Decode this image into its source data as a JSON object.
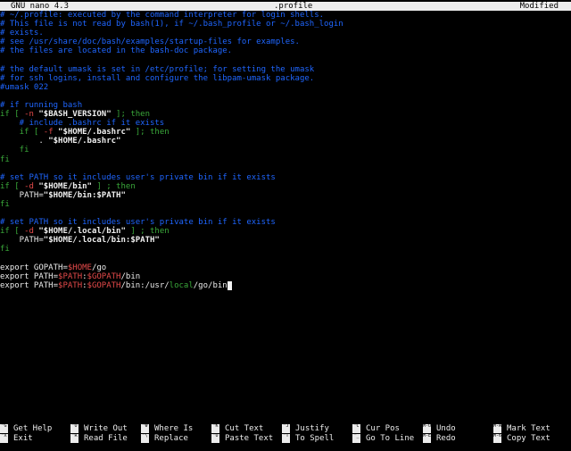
{
  "titlebar": {
    "app": "GNU nano 4.3",
    "filename": ".profile",
    "status": "Modified"
  },
  "editor": {
    "lines": [
      [
        {
          "c": "c",
          "t": "# ~/.profile: executed by the command interpreter for login shells."
        }
      ],
      [
        {
          "c": "c",
          "t": "# This file is not read by bash(1), if ~/.bash_profile or ~/.bash_login"
        }
      ],
      [
        {
          "c": "c",
          "t": "# exists."
        }
      ],
      [
        {
          "c": "c",
          "t": "# see /usr/share/doc/bash/examples/startup-files for examples."
        }
      ],
      [
        {
          "c": "c",
          "t": "# the files are located in the bash-doc package."
        }
      ],
      [],
      [
        {
          "c": "c",
          "t": "# the default umask is set in /etc/profile; for setting the umask"
        }
      ],
      [
        {
          "c": "c",
          "t": "# for ssh logins, install and configure the libpam-umask package."
        }
      ],
      [
        {
          "c": "c",
          "t": "#umask 022"
        }
      ],
      [],
      [
        {
          "c": "c",
          "t": "# if running bash"
        }
      ],
      [
        {
          "c": "k",
          "t": "if [ "
        },
        {
          "c": "v",
          "t": "-n "
        },
        {
          "c": "s",
          "t": "\"$BASH_VERSION\""
        },
        {
          "c": "k",
          "t": " ]; then"
        }
      ],
      [
        {
          "c": "c",
          "t": "    # include .bashrc if it exists"
        }
      ],
      [
        {
          "c": "k",
          "t": "    if [ "
        },
        {
          "c": "v",
          "t": "-f "
        },
        {
          "c": "s",
          "t": "\"$HOME/.bashrc\""
        },
        {
          "c": "k",
          "t": " ]; then"
        }
      ],
      [
        {
          "c": "t",
          "t": "        . "
        },
        {
          "c": "s",
          "t": "\"$HOME/.bashrc\""
        }
      ],
      [
        {
          "c": "k",
          "t": "    fi"
        }
      ],
      [
        {
          "c": "k",
          "t": "fi"
        }
      ],
      [],
      [
        {
          "c": "c",
          "t": "# set PATH so it includes user's private bin if it exists"
        }
      ],
      [
        {
          "c": "k",
          "t": "if [ "
        },
        {
          "c": "v",
          "t": "-d "
        },
        {
          "c": "s",
          "t": "\"$HOME/bin\""
        },
        {
          "c": "k",
          "t": " ] ; then"
        }
      ],
      [
        {
          "c": "t",
          "t": "    PATH="
        },
        {
          "c": "s",
          "t": "\"$HOME/bin:$PATH\""
        }
      ],
      [
        {
          "c": "k",
          "t": "fi"
        }
      ],
      [],
      [
        {
          "c": "c",
          "t": "# set PATH so it includes user's private bin if it exists"
        }
      ],
      [
        {
          "c": "k",
          "t": "if [ "
        },
        {
          "c": "v",
          "t": "-d "
        },
        {
          "c": "s",
          "t": "\"$HOME/.local/bin\""
        },
        {
          "c": "k",
          "t": " ] ; then"
        }
      ],
      [
        {
          "c": "t",
          "t": "    PATH="
        },
        {
          "c": "s",
          "t": "\"$HOME/.local/bin:$PATH\""
        }
      ],
      [
        {
          "c": "k",
          "t": "fi"
        }
      ],
      [],
      [
        {
          "c": "t",
          "t": "export GOPATH="
        },
        {
          "c": "v",
          "t": "$HOME"
        },
        {
          "c": "t",
          "t": "/go"
        }
      ],
      [
        {
          "c": "t",
          "t": "export PATH="
        },
        {
          "c": "v",
          "t": "$PATH"
        },
        {
          "c": "t",
          "t": ":"
        },
        {
          "c": "v",
          "t": "$GOPATH"
        },
        {
          "c": "t",
          "t": "/bin"
        }
      ],
      [
        {
          "c": "t",
          "t": "export PATH="
        },
        {
          "c": "v",
          "t": "$PATH"
        },
        {
          "c": "t",
          "t": ":"
        },
        {
          "c": "v",
          "t": "$GOPATH"
        },
        {
          "c": "t",
          "t": "/bin:/usr/"
        },
        {
          "c": "k",
          "t": "local"
        },
        {
          "c": "t",
          "t": "/go/bin"
        }
      ]
    ],
    "cursor_line": 30
  },
  "shortcuts": [
    {
      "key": "^G",
      "label": "Get Help"
    },
    {
      "key": "^O",
      "label": "Write Out"
    },
    {
      "key": "^W",
      "label": "Where Is"
    },
    {
      "key": "^K",
      "label": "Cut Text"
    },
    {
      "key": "^J",
      "label": "Justify"
    },
    {
      "key": "^C",
      "label": "Cur Pos"
    },
    {
      "key": "M-U",
      "label": "Undo"
    },
    {
      "key": "M-A",
      "label": "Mark Text"
    },
    {
      "key": "^X",
      "label": "Exit"
    },
    {
      "key": "^R",
      "label": "Read File"
    },
    {
      "key": "^\\",
      "label": "Replace"
    },
    {
      "key": "^U",
      "label": "Paste Text"
    },
    {
      "key": "^T",
      "label": "To Spell"
    },
    {
      "key": "^_",
      "label": "Go To Line"
    },
    {
      "key": "M-E",
      "label": "Redo"
    },
    {
      "key": "M-6",
      "label": "Copy Text"
    }
  ],
  "colors": {
    "comment": "#1f66ff",
    "keyword": "#3aa83a",
    "string": "#f0f0f0",
    "variable": "#e54a4a",
    "background": "#000000",
    "titlebar": "#ededed"
  }
}
